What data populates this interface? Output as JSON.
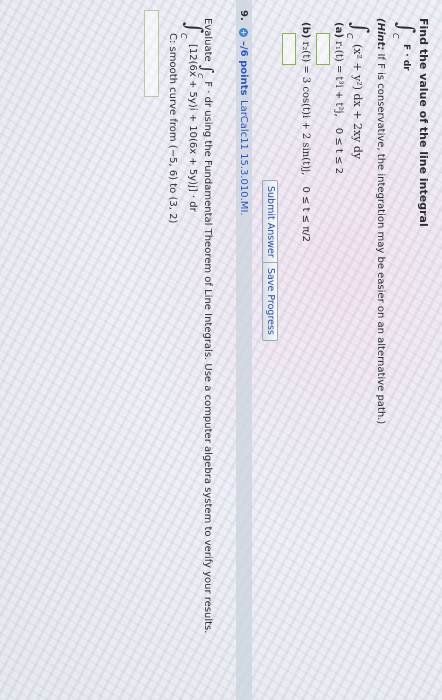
{
  "q8": {
    "heading": "Find the value of the line integral",
    "integral_lower": "C",
    "integrand": "F · dr",
    "hint_label": "(Hint:",
    "hint_text": "If F is conservative, the integration may be easier on an alternative path.)",
    "expr": "(x² + y²) dx + 2xy dy",
    "part_a": {
      "label": "(a)",
      "formula": "r₁(t) = t³i + t²j,",
      "range": "0 ≤ t ≤ 2"
    },
    "part_b": {
      "label": "(b)",
      "formula": "r₂(t) = 3 cos(t)i + 2 sin(t)j,",
      "range": "0 ≤ t ≤ π/2"
    },
    "submit_label": "Submit Answer",
    "save_label": "Save Progress"
  },
  "q9": {
    "number": "9.",
    "points": "–/6 points",
    "source": "LarCalc11 15.3.010.MI.",
    "evaluate_prefix": "Evaluate",
    "evaluate_integral_lower": "C",
    "evaluate_suffix": "F · dr using the Fundamental Theorem of Line Integrals. Use a computer algebra system to verify your results.",
    "integral_lower": "C",
    "expr": "[12(6x + 5y)i + 10(6x + 5y)j] · dr",
    "curve": "C: smooth curve from (−5, 6) to (3, 2)"
  }
}
